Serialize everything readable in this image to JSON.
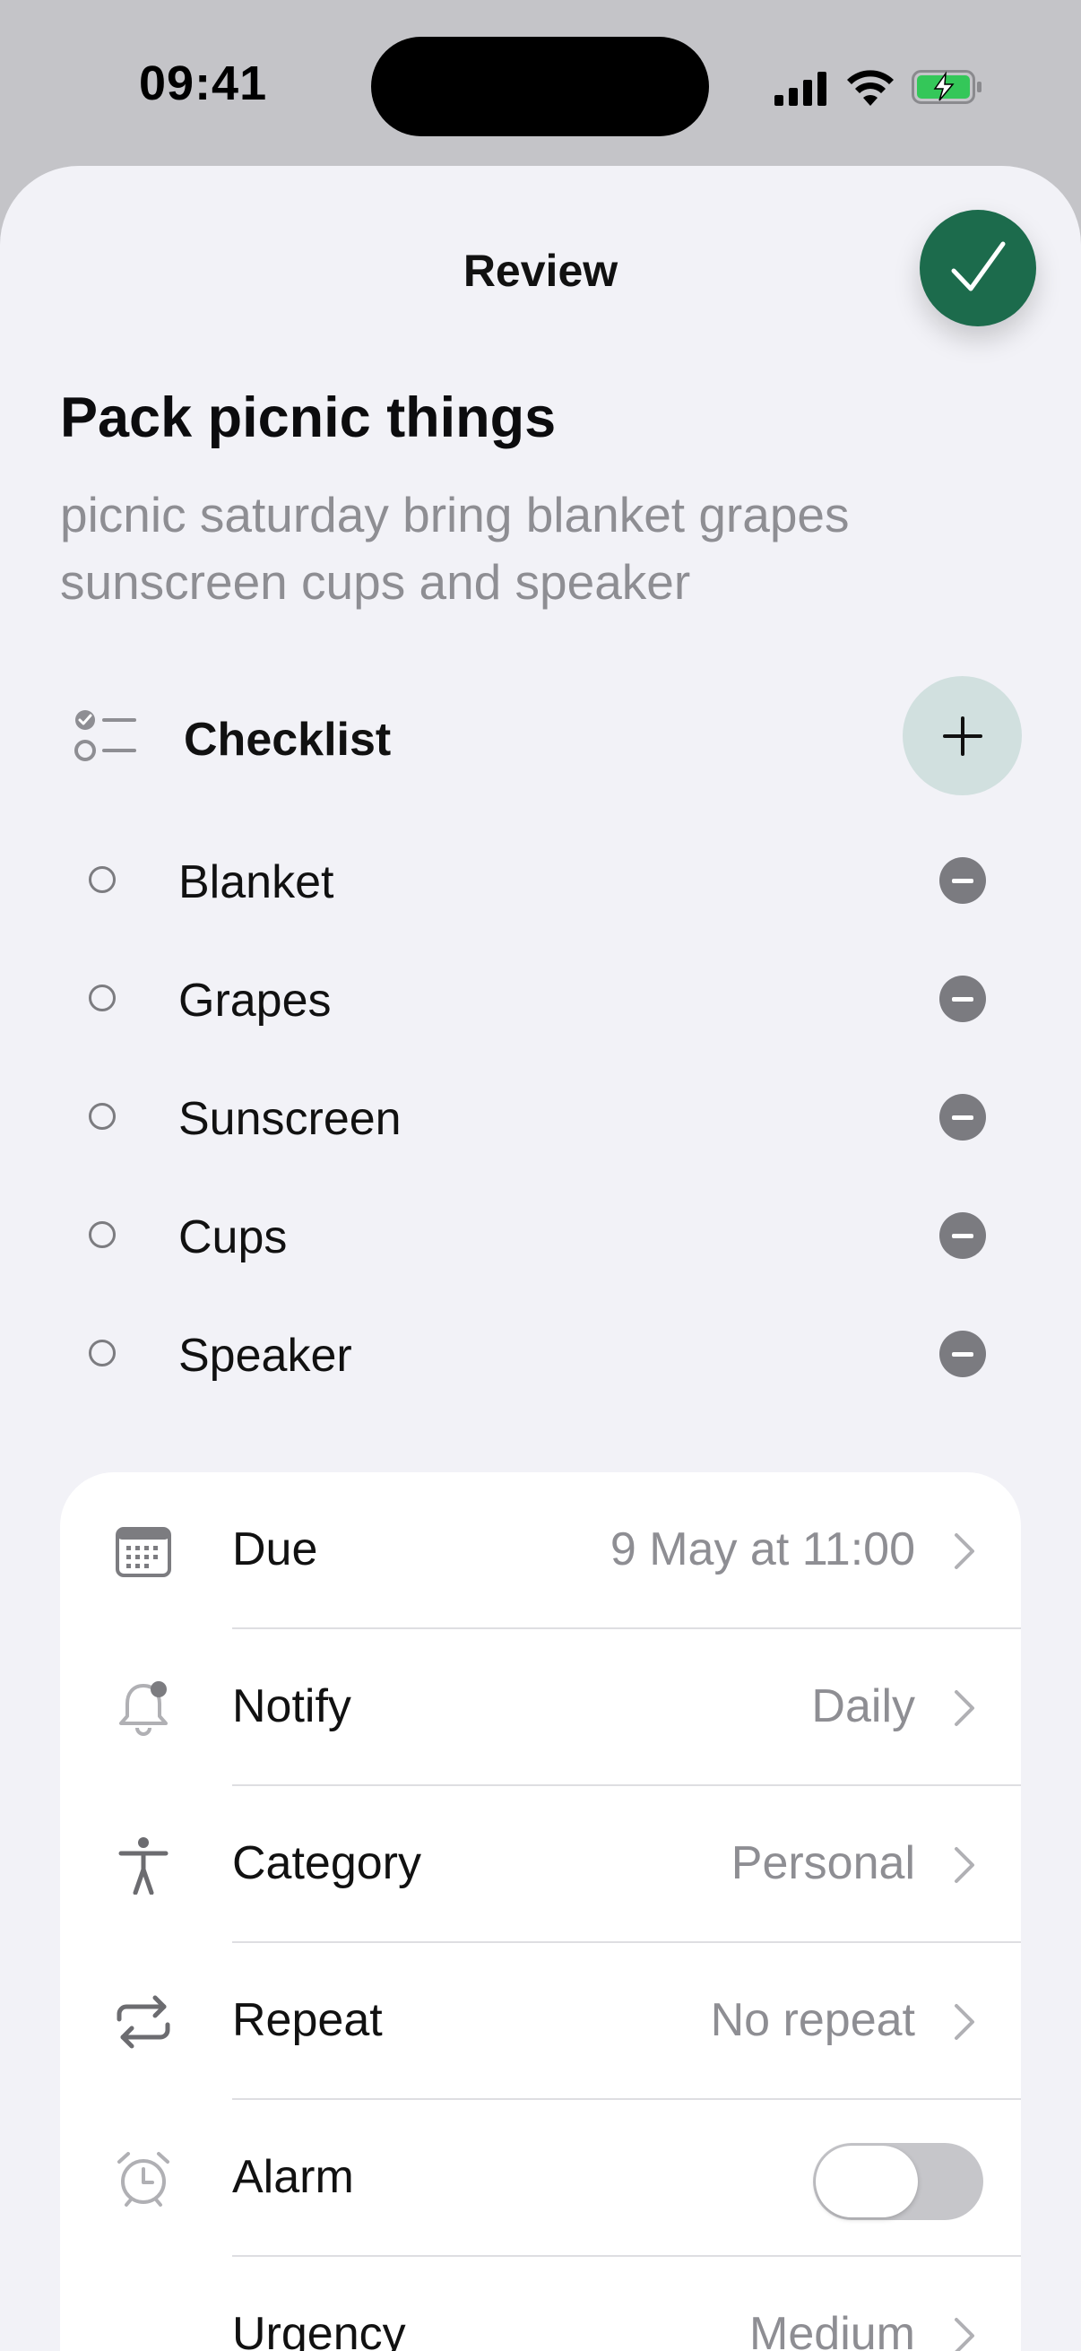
{
  "status_bar": {
    "time": "09:41"
  },
  "sheet": {
    "title": "Review"
  },
  "task": {
    "title": "Pack picnic things",
    "description": "picnic saturday bring blanket grapes sunscreen cups and speaker"
  },
  "checklist": {
    "label": "Checklist",
    "items": [
      {
        "label": "Blanket"
      },
      {
        "label": "Grapes"
      },
      {
        "label": "Sunscreen"
      },
      {
        "label": "Cups"
      },
      {
        "label": "Speaker"
      }
    ]
  },
  "settings": {
    "due": {
      "label": "Due",
      "value": "9 May at 11:00",
      "icon": "calendar-icon"
    },
    "notify": {
      "label": "Notify",
      "value": "Daily",
      "icon": "bell-icon"
    },
    "category": {
      "label": "Category",
      "value": "Personal",
      "icon": "person-icon"
    },
    "repeat": {
      "label": "Repeat",
      "value": "No repeat",
      "icon": "repeat-icon"
    },
    "alarm": {
      "label": "Alarm",
      "enabled": false,
      "icon": "alarm-icon"
    },
    "urgency": {
      "label": "Urgency",
      "value": "Medium",
      "icon": "urgency-icon"
    }
  },
  "colors": {
    "accent": "#1c6b4c",
    "add_button_bg": "#d1e0df",
    "battery_charging": "#34c759"
  }
}
